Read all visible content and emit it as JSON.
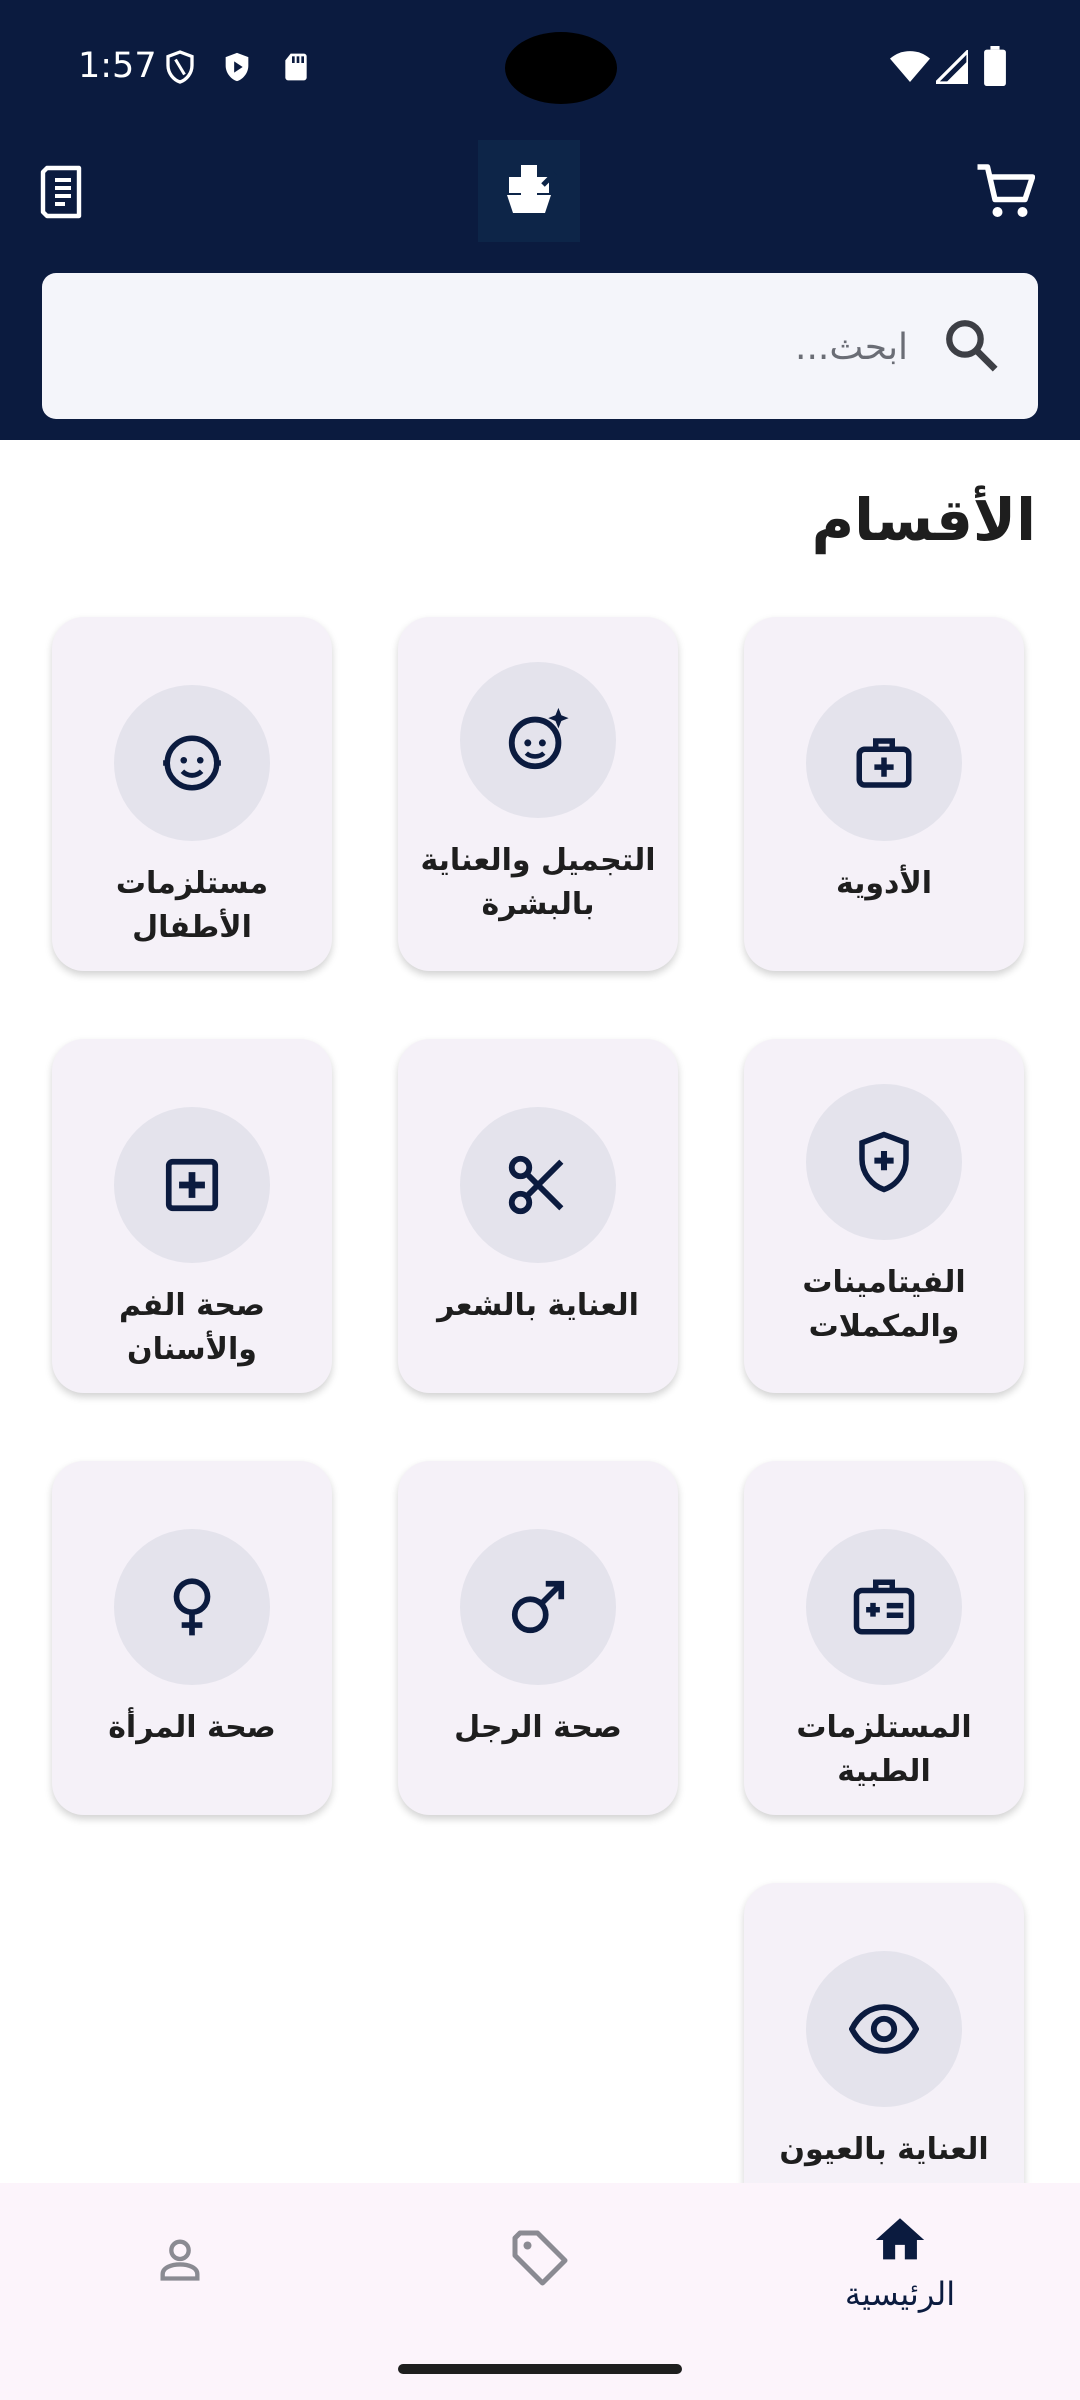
{
  "status_bar": {
    "time": "1:57"
  },
  "search": {
    "placeholder": "ابحث..."
  },
  "categories_title": "الأقسام",
  "categories": [
    {
      "label": "الأدوية",
      "icon": "medical-kit-icon"
    },
    {
      "label": "التجميل والعناية بالبشرة",
      "icon": "face-sparkle-icon"
    },
    {
      "label": "مستلزمات الأطفال",
      "icon": "baby-face-icon"
    },
    {
      "label": "الفيتامينات والمكملات",
      "icon": "shield-plus-icon"
    },
    {
      "label": "العناية بالشعر",
      "icon": "scissors-icon"
    },
    {
      "label": "صحة الفم والأسنان",
      "icon": "plus-box-icon"
    },
    {
      "label": "المستلزمات الطبية",
      "icon": "medical-id-icon"
    },
    {
      "label": "صحة الرجل",
      "icon": "male-symbol-icon"
    },
    {
      "label": "صحة المرأة",
      "icon": "female-symbol-icon"
    },
    {
      "label": "العناية بالعيون",
      "icon": "eye-icon"
    }
  ],
  "bottom_nav": {
    "home_label": "الرئيسية"
  },
  "colors": {
    "header_bg": "#0b1b3f",
    "card_bg": "#f5f1f8",
    "circle_bg": "#e4e3ec",
    "nav_bg": "#fcf4fb"
  }
}
